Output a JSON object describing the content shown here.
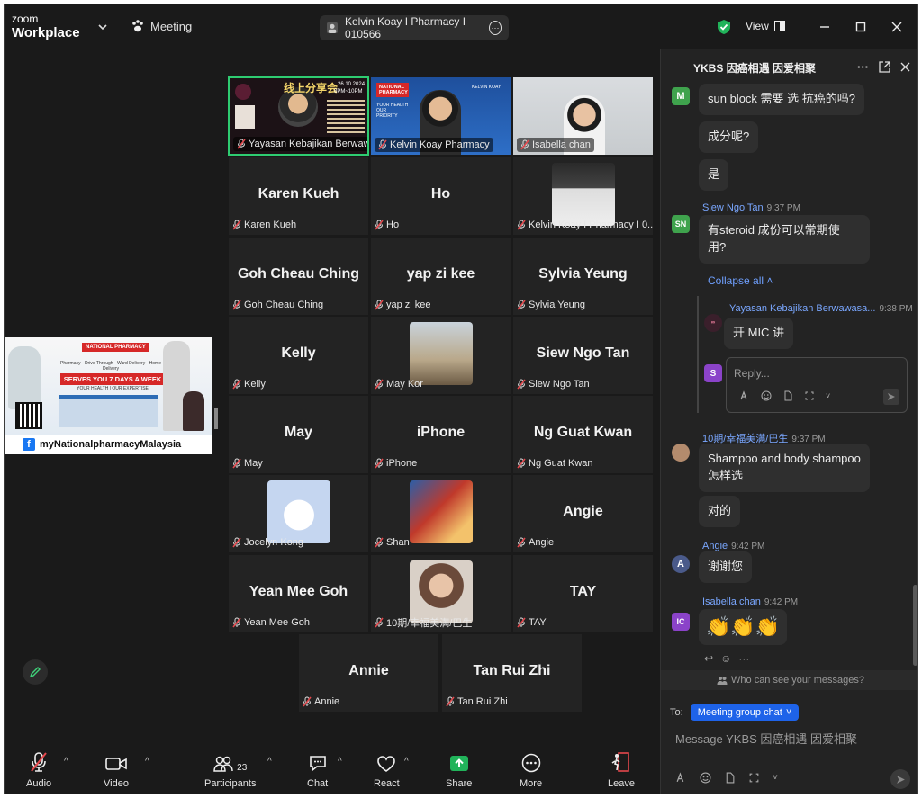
{
  "app": {
    "logo_top": "zoom",
    "logo_bottom": "Workplace",
    "meeting_label": "Meeting",
    "host_name": "Kelvin Koay I Pharmacy I 010566",
    "view_label": "View"
  },
  "share_thumbnail": {
    "badge": "NATIONAL PHARMACY",
    "services": "Pharmacy · Drive Through · Ward Delivery · Home Delivery",
    "headline": "SERVES YOU 7 DAYS A WEEK",
    "tagline": "YOUR HEALTH | OUR EXPERTISE",
    "footer": "myNationalpharmacyMalaysia"
  },
  "tiles": [
    {
      "display": "",
      "label": "Yayasan Kebajikan Berwawasa...",
      "kind": "poster"
    },
    {
      "display": "",
      "label": "Kelvin Koay Pharmacy",
      "kind": "banner"
    },
    {
      "display": "",
      "label": "Isabella chan",
      "kind": "camera"
    },
    {
      "display": "Karen Kueh",
      "label": "Karen Kueh",
      "kind": "name"
    },
    {
      "display": "Ho",
      "label": "Ho",
      "kind": "name"
    },
    {
      "display": "",
      "label": "Kelvin Koay I Pharmacy I 0...",
      "kind": "photo"
    },
    {
      "display": "Goh Cheau Ching",
      "label": "Goh Cheau Ching",
      "kind": "name"
    },
    {
      "display": "yap zi kee",
      "label": "yap zi kee",
      "kind": "name"
    },
    {
      "display": "Sylvia Yeung",
      "label": "Sylvia Yeung",
      "kind": "name"
    },
    {
      "display": "Kelly",
      "label": "Kelly",
      "kind": "name"
    },
    {
      "display": "",
      "label": "May Kor",
      "kind": "photo"
    },
    {
      "display": "Siew Ngo Tan",
      "label": "Siew Ngo Tan",
      "kind": "name"
    },
    {
      "display": "May",
      "label": "May",
      "kind": "name"
    },
    {
      "display": "iPhone",
      "label": "iPhone",
      "kind": "name"
    },
    {
      "display": "Ng Guat Kwan",
      "label": "Ng Guat Kwan",
      "kind": "name"
    },
    {
      "display": "",
      "label": "Jocelyn Kong",
      "kind": "photo"
    },
    {
      "display": "",
      "label": "Shan",
      "kind": "photo"
    },
    {
      "display": "Angie",
      "label": "Angie",
      "kind": "name"
    },
    {
      "display": "Yean Mee Goh",
      "label": "Yean Mee Goh",
      "kind": "name"
    },
    {
      "display": "",
      "label": "10期/幸福美满/巴生",
      "kind": "photo"
    },
    {
      "display": "TAY",
      "label": "TAY",
      "kind": "name"
    },
    {
      "display": "Annie",
      "label": "Annie",
      "kind": "name"
    },
    {
      "display": "Tan Rui Zhi",
      "label": "Tan Rui Zhi",
      "kind": "name"
    }
  ],
  "poster_tile": {
    "title": "线上分享会",
    "date": "26.10.2024",
    "time": "8PM~10PM"
  },
  "banner_tile": {
    "brand": "NATIONAL PHARMACY",
    "slogan": "YOUR HEALTH OUR PRIORITY",
    "name": "KELVIN KOAY"
  },
  "toolbar": {
    "audio": "Audio",
    "video": "Video",
    "participants": "Participants",
    "participants_count": "23",
    "chat": "Chat",
    "react": "React",
    "share": "Share",
    "more": "More",
    "leave": "Leave"
  },
  "chat": {
    "title": "YKBS 因癌相遇 因爱相聚",
    "messages": {
      "m_avatar": "M",
      "m1": "sun block 需要 选 抗癌的吗?",
      "m2": "成分呢?",
      "m3": "是",
      "sn_sender": "Siew Ngo Tan",
      "sn_time": "9:37 PM",
      "sn_avatar": "SN",
      "sn_line1": "有steroid 成份可以常期使",
      "sn_line2": "用?",
      "collapse_all": "Collapse all",
      "reply_sender": "Yayasan Kebajikan Berwawasa...",
      "reply_time": "9:38 PM",
      "reply_text": "开 MIC 讲",
      "reply_placeholder": "Reply...",
      "reply_avatar": "S",
      "b_sender": "10期/幸福美满/巴生",
      "b_time": "9:37 PM",
      "b_line1": "Shampoo and body shampoo",
      "b_line2": "怎样选",
      "b2": "对的",
      "a_sender": "Angie",
      "a_time": "9:42 PM",
      "a_avatar": "A",
      "a_text": "谢谢您",
      "ic_sender": "Isabella chan",
      "ic_time": "9:42 PM",
      "ic_avatar": "IC",
      "ic_text": "👏👏👏"
    },
    "who_can_see": "Who can see your messages?",
    "to_label": "To:",
    "to_chip": "Meeting group chat",
    "input_placeholder": "Message YKBS 因癌相遇 因爱相聚"
  },
  "colors": {
    "accent_blue": "#1e63e9",
    "active_speaker": "#2ecc71",
    "muted_red": "#e5484d",
    "share_green": "#21b35a"
  }
}
